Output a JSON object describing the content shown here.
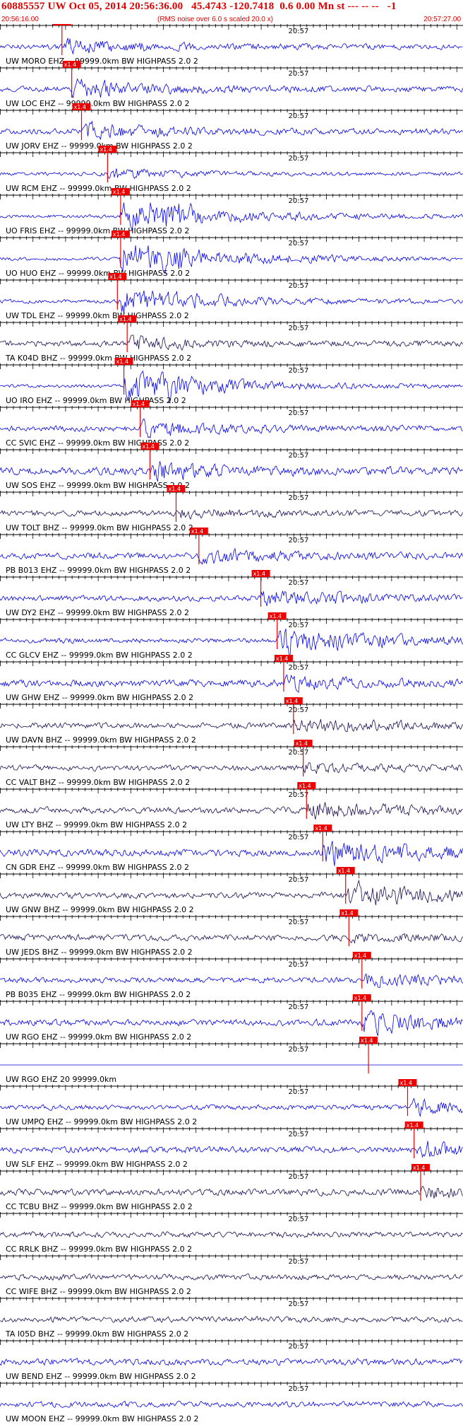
{
  "header": {
    "title": "60885557 UW Oct 05, 2014 20:56:36.00   45.4743 -120.7418  0.6 0.00 Mn st --- -- --   -1",
    "start_time": "20:56:16.00",
    "note": "(RMS noise over 6.0 s scaled 20.0 x)",
    "end_time": "20:57:27.00"
  },
  "colors": {
    "blue_trace": "#0000ee",
    "dark_trace": "#1a0a50",
    "pick_box": "#ee0000",
    "pick_line": "#ee0000",
    "axis": "#000000",
    "header_text": "#e00000"
  },
  "chart_data": {
    "type": "line",
    "title": "60885557 UW Oct 05, 2014 20:56:36.00   45.4743 -120.7418  0.6 0.00 Mn st --- -- --   -1",
    "x_range": [
      "20:56:16.00",
      "20:57:27.00"
    ],
    "x_start_seconds": 0,
    "x_end_seconds": 71,
    "minute_mark_label": "20:57",
    "minute_mark_seconds": 44,
    "pick_label": "x1.4",
    "traces": [
      {
        "label": "UW MORO EHZ -- 99999.0km BW  HIGHPASS  2.0  2",
        "color": "blue",
        "pick": 9.5,
        "amp": 14,
        "noise": 0.25,
        "burst": 0.6
      },
      {
        "label": "UW LOC EHZ -- 99999.0km BW  HIGHPASS  2.0  2",
        "color": "blue",
        "pick": 11.0,
        "amp": 16,
        "noise": 0.3,
        "burst": 0.7
      },
      {
        "label": "UW JORV EHZ -- 99999.0km BW  HIGHPASS  2.0  2",
        "color": "blue",
        "pick": 12.5,
        "amp": 13,
        "noise": 0.3,
        "burst": 0.7
      },
      {
        "label": "UW RCM EHZ -- 99999.0km BW  HIGHPASS  2.0  2",
        "color": "blue",
        "pick": 16.5,
        "amp": 10,
        "noise": 0.15,
        "burst": 0.5
      },
      {
        "label": "UO FRIS EHZ -- 99999.0km BW  HIGHPASS  2.0  2",
        "color": "blue",
        "pick": 18.5,
        "amp": 30,
        "noise": 0.12,
        "burst": 1.0,
        "clipped": true
      },
      {
        "label": "UO HUO EHZ -- 99999.0km BW  HIGHPASS  2.0  2",
        "color": "blue",
        "pick": 18.5,
        "amp": 30,
        "noise": 0.12,
        "burst": 1.0,
        "clipped": true
      },
      {
        "label": "UW TDL EHZ -- 99999.0km BW  HIGHPASS  2.0  2",
        "color": "blue",
        "pick": 18.0,
        "amp": 26,
        "noise": 0.15,
        "burst": 0.9
      },
      {
        "label": "TA K04D BHZ -- 99999.0km BW  HIGHPASS  2.0  2",
        "color": "dark",
        "pick": 19.5,
        "amp": 12,
        "noise": 0.3,
        "burst": 0.5
      },
      {
        "label": "UO IRO EHZ -- 99999.0km BW  HIGHPASS  2.0  2",
        "color": "blue",
        "pick": 19.0,
        "amp": 30,
        "noise": 0.12,
        "burst": 1.0,
        "clipped": true
      },
      {
        "label": "CC SVIC EHZ -- 99999.0km BW  HIGHPASS  2.0  2",
        "color": "blue",
        "pick": 21.5,
        "amp": 14,
        "noise": 0.3,
        "burst": 0.6
      },
      {
        "label": "UW SOS EHZ -- 99999.0km BW  HIGHPASS  2.0  2",
        "color": "blue",
        "pick": 23.0,
        "amp": 15,
        "noise": 0.45,
        "burst": 0.6
      },
      {
        "label": "UW TOLT BHZ -- 99999.0km BW  HIGHPASS  2.0  2",
        "color": "dark",
        "pick": 27.0,
        "amp": 8,
        "noise": 0.3,
        "burst": 0.5
      },
      {
        "label": "PB B013 EHZ -- 99999.0km BW  HIGHPASS  2.0  2",
        "color": "blue",
        "pick": 30.5,
        "amp": 12,
        "noise": 0.35,
        "burst": 0.6
      },
      {
        "label": "UW DY2 EHZ -- 99999.0km BW  HIGHPASS  2.0  2",
        "color": "blue",
        "pick": 40.0,
        "amp": 15,
        "noise": 0.3,
        "burst": 0.7
      },
      {
        "label": "CC GLCV EHZ -- 99999.0km BW  HIGHPASS  2.0  2",
        "color": "blue",
        "pick": 42.5,
        "amp": 24,
        "noise": 0.25,
        "burst": 1.0
      },
      {
        "label": "UW GHW EHZ -- 99999.0km BW  HIGHPASS  2.0  2",
        "color": "blue",
        "pick": 43.5,
        "amp": 10,
        "noise": 0.4,
        "burst": 0.5
      },
      {
        "label": "UW DAVN BHZ -- 99999.0km BW  HIGHPASS  2.0  2",
        "color": "dark",
        "pick": 45.0,
        "amp": 12,
        "noise": 0.3,
        "burst": 0.8
      },
      {
        "label": "CC VALT BHZ -- 99999.0km BW  HIGHPASS  2.0  2",
        "color": "dark",
        "pick": 46.5,
        "amp": 8,
        "noise": 0.3,
        "burst": 0.6
      },
      {
        "label": "UW LTY BHZ -- 99999.0km BW  HIGHPASS  2.0  2",
        "color": "dark",
        "pick": 47.0,
        "amp": 15,
        "noise": 0.35,
        "burst": 0.7
      },
      {
        "label": "CN GDR EHZ -- 99999.0km BW  HIGHPASS  2.0  2",
        "color": "blue",
        "pick": 49.5,
        "amp": 22,
        "noise": 0.4,
        "burst": 1.0
      },
      {
        "label": "UW GNW BHZ -- 99999.0km BW  HIGHPASS  2.0  2",
        "color": "dark",
        "pick": 53.0,
        "amp": 20,
        "noise": 0.35,
        "burst": 1.0
      },
      {
        "label": "UW JEDS BHZ -- 99999.0km BW  HIGHPASS  2.0  2",
        "color": "dark",
        "pick": 53.5,
        "amp": 6,
        "noise": 0.35,
        "burst": 0.5
      },
      {
        "label": "PB B035 EHZ -- 99999.0km BW  HIGHPASS  2.0  2",
        "color": "blue",
        "pick": 55.5,
        "amp": 12,
        "noise": 0.3,
        "burst": 0.6
      },
      {
        "label": "UW RGO EHZ -- 99999.0km BW  HIGHPASS  2.0  2",
        "color": "blue",
        "pick": 55.5,
        "amp": 20,
        "noise": 0.35,
        "burst": 0.8
      },
      {
        "label": "UW RGO EHZ 20 99999.0km",
        "color": "blue",
        "pick": 56.5,
        "amp": 0,
        "noise": 0,
        "burst": 0,
        "flat": true
      },
      {
        "label": "UW UMPQ EHZ -- 99999.0km BW  HIGHPASS  2.0  2",
        "color": "blue",
        "pick": 62.5,
        "amp": 15,
        "noise": 0.25,
        "burst": 0.6
      },
      {
        "label": "UW SLF EHZ -- 99999.0km BW  HIGHPASS  2.0  2",
        "color": "blue",
        "pick": 63.5,
        "amp": 14,
        "noise": 0.35,
        "burst": 0.6
      },
      {
        "label": "CC TCBU BHZ -- 99999.0km BW  HIGHPASS  2.0  2",
        "color": "dark",
        "pick": 64.5,
        "amp": 10,
        "noise": 0.35,
        "burst": 0.5
      },
      {
        "label": "CC RRLK BHZ -- 99999.0km BW  HIGHPASS  2.0  2",
        "color": "dark",
        "pick": null,
        "amp": 0,
        "noise": 0.3,
        "burst": 0
      },
      {
        "label": "CC WIFE BHZ -- 99999.0km BW  HIGHPASS  2.0  2",
        "color": "dark",
        "pick": null,
        "amp": 0,
        "noise": 0.3,
        "burst": 0
      },
      {
        "label": "TA I05D BHZ -- 99999.0km BW  HIGHPASS  2.0  2",
        "color": "dark",
        "pick": null,
        "amp": 0,
        "noise": 0.3,
        "burst": 0
      },
      {
        "label": "UW BEND EHZ -- 99999.0km BW  HIGHPASS  2.0  2",
        "color": "blue",
        "pick": null,
        "amp": 0,
        "noise": 0.35,
        "burst": 0
      },
      {
        "label": "UW MOON EHZ -- 99999.0km BW  HIGHPASS  2.0  2",
        "color": "blue",
        "pick": null,
        "amp": 0,
        "noise": 0.3,
        "burst": 0
      }
    ]
  }
}
